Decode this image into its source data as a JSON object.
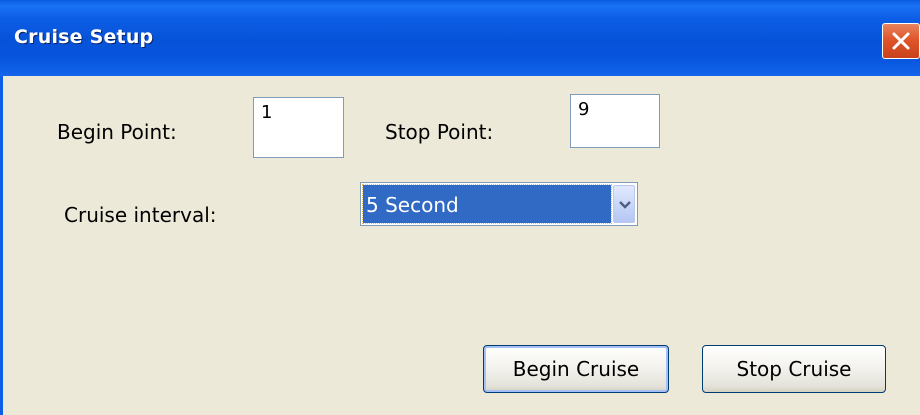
{
  "window": {
    "title": "Cruise Setup",
    "close_icon": "close-icon"
  },
  "form": {
    "begin_point_label": "Begin Point:",
    "begin_point_value": "1",
    "stop_point_label": "Stop Point:",
    "stop_point_value": "9",
    "cruise_interval_label": "Cruise interval:",
    "cruise_interval_selected": "5 Second"
  },
  "buttons": {
    "begin_cruise": "Begin Cruise",
    "stop_cruise": "Stop Cruise"
  },
  "colors": {
    "titlebar": "#0653d8",
    "close_button": "#e0552a",
    "dialog_background": "#ece9d8",
    "selection_highlight": "#316ac5"
  }
}
